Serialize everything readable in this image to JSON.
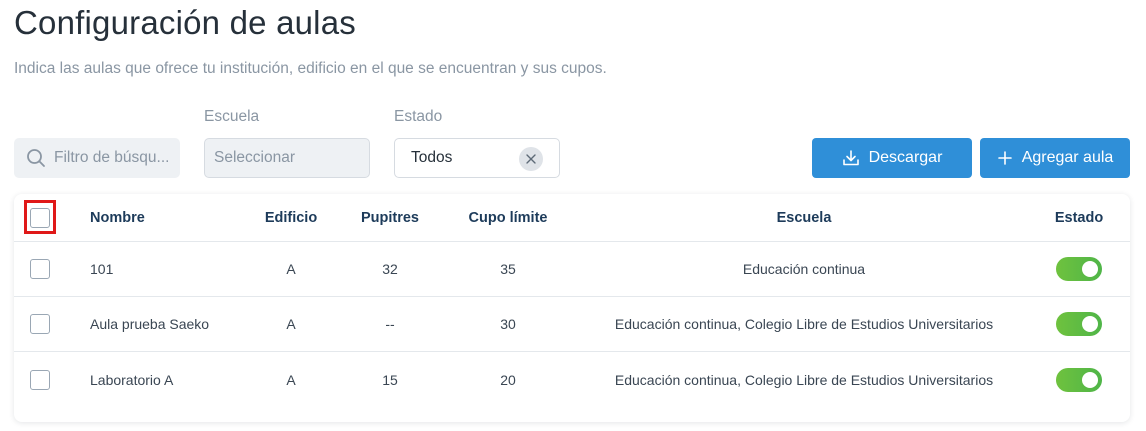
{
  "page": {
    "title": "Configuración de aulas",
    "subtitle": "Indica las aulas que ofrece tu institución, edificio en el que se encuentran y sus cupos."
  },
  "filters": {
    "search_placeholder": "Filtro de búsqu...",
    "escuela_label": "Escuela",
    "escuela_value": "Seleccionar",
    "estado_label": "Estado",
    "estado_value": "Todos"
  },
  "actions": {
    "download_label": "Descargar",
    "add_label": "Agregar aula"
  },
  "table": {
    "columns": [
      "Nombre",
      "Edificio",
      "Pupitres",
      "Cupo límite",
      "Escuela",
      "Estado"
    ],
    "rows": [
      {
        "nombre": "101",
        "edificio": "A",
        "pupitres": "32",
        "cupo": "35",
        "escuela": "Educación continua",
        "estado_on": true
      },
      {
        "nombre": "Aula prueba Saeko",
        "edificio": "A",
        "pupitres": "--",
        "cupo": "30",
        "escuela": "Educación continua, Colegio Libre de Estudios Universitarios",
        "estado_on": true
      },
      {
        "nombre": "Laboratorio A",
        "edificio": "A",
        "pupitres": "15",
        "cupo": "20",
        "escuela": "Educación continua, Colegio Libre de Estudios Universitarios",
        "estado_on": true
      }
    ]
  },
  "icons": {
    "search": "search-icon",
    "clear": "close-icon",
    "download": "download-icon",
    "add": "plus-icon"
  },
  "colors": {
    "primary_button": "#2f8fd8",
    "toggle_on": "#5cbb45",
    "highlight_border": "#e01818"
  }
}
